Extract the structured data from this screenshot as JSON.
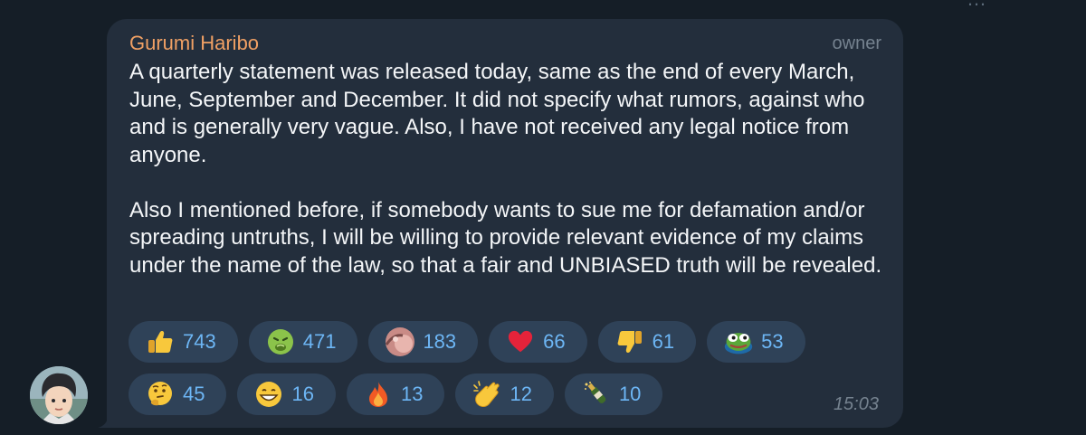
{
  "top_hint": "…",
  "message": {
    "sender": "Gurumi Haribo",
    "role": "owner",
    "paragraphs": [
      "A quarterly statement was released today, same as the end of every March, June, September and December. It did not specify what rumors, against who and is generally very vague. Also, I have not received any legal notice from anyone.",
      "Also I mentioned before, if somebody wants to sue me for defamation and/or spreading untruths, I will be willing to provide relevant evidence of my claims under the name of the law, so that a fair and UNBIASED truth will be revealed."
    ],
    "time": "15:03",
    "sender_color": "#f0a064",
    "accent_color": "#6db6f5"
  },
  "reactions": [
    {
      "icon": "thumbs-up-icon",
      "count": "743"
    },
    {
      "icon": "nauseated-face-icon",
      "count": "471"
    },
    {
      "icon": "custom-sticker-icon",
      "count": "183"
    },
    {
      "icon": "red-heart-icon",
      "count": "66"
    },
    {
      "icon": "thumbs-down-icon",
      "count": "61"
    },
    {
      "icon": "pepe-frog-icon",
      "count": "53"
    },
    {
      "icon": "thinking-face-icon",
      "count": "45"
    },
    {
      "icon": "grinning-face-icon",
      "count": "16"
    },
    {
      "icon": "fire-icon",
      "count": "13"
    },
    {
      "icon": "clapping-hands-icon",
      "count": "12"
    },
    {
      "icon": "champagne-icon",
      "count": "10"
    }
  ]
}
